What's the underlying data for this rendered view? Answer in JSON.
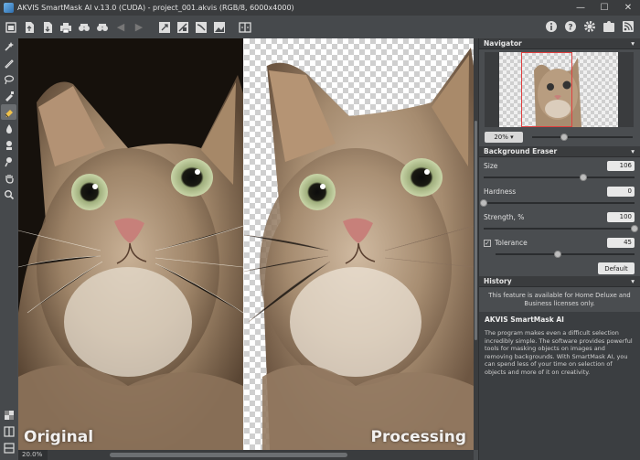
{
  "window": {
    "title": "AKVIS SmartMask AI v.13.0 (CUDA) - project_001.akvis (RGB/8, 6000x4000)",
    "minimize": "—",
    "maximize": "☐",
    "close": "✕"
  },
  "toolbar": {
    "left_icons": [
      "home-icon",
      "open-file-icon",
      "save-file-icon",
      "print-icon",
      "share-icon",
      "share-alt-icon",
      "undo-icon",
      "redo-icon",
      "select-tool-icon",
      "mask-icon",
      "auto-select-icon",
      "background-icon",
      "compare-icon"
    ],
    "right_icons": [
      "info-icon",
      "help-icon",
      "settings-icon",
      "plugin-icon",
      "feed-icon"
    ]
  },
  "tools": [
    "magic-brush-icon",
    "selection-brush-icon",
    "lasso-icon",
    "dropper-icon",
    "background-eraser-icon",
    "drop-icon",
    "stamp-icon",
    "history-brush-icon",
    "hand-icon",
    "zoom-icon"
  ],
  "canvas": {
    "left_label": "Original",
    "right_label": "Processing",
    "zoom_readout": "20.0%"
  },
  "navigator": {
    "title": "Navigator",
    "zoom": "20%",
    "zoom_slider": 0.32
  },
  "background_eraser": {
    "title": "Background Eraser",
    "size": {
      "label": "Size",
      "value": "106",
      "level": 0.66
    },
    "hardness": {
      "label": "Hardness",
      "value": "0",
      "level": 0.0
    },
    "strength": {
      "label": "Strength, %",
      "value": "100",
      "level": 1.0
    },
    "tolerance": {
      "label": "Tolerance",
      "value": "45",
      "level": 0.45,
      "checked": true
    },
    "default_button": "Default"
  },
  "history": {
    "title": "History",
    "note": "This feature is available for Home Deluxe and Business licenses only."
  },
  "about": {
    "title": "AKVIS SmartMask AI",
    "text": "The program makes even a difficult selection incredibly simple. The software provides powerful tools for masking objects on images and removing backgrounds. With SmartMask AI, you can spend less of your time on selection of objects and more of it on creativity."
  }
}
